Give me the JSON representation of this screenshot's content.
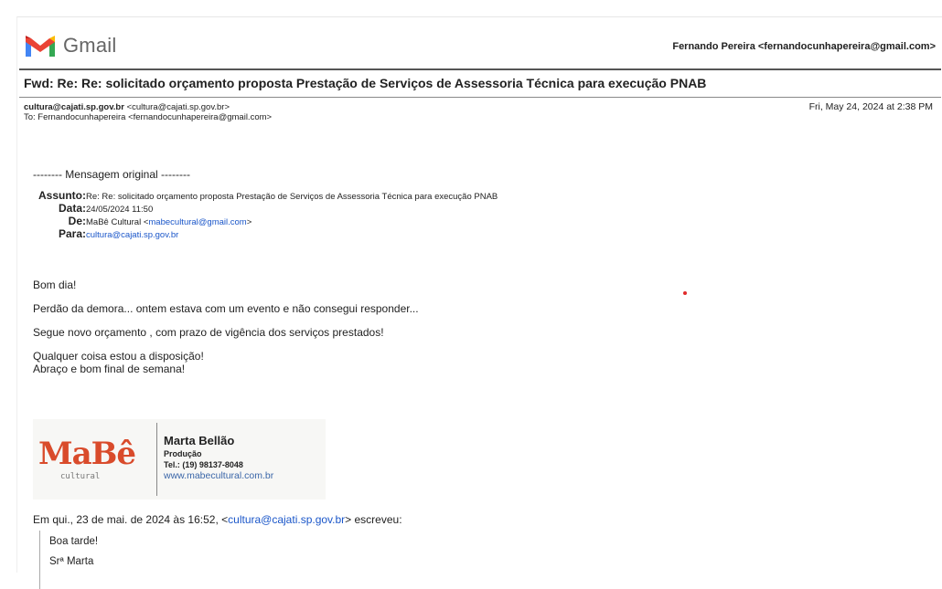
{
  "header": {
    "app_name": "Gmail",
    "account": "Fernando Pereira <fernandocunhapereira@gmail.com>"
  },
  "email": {
    "subject": "Fwd: Re: Re: solicitado orçamento proposta Prestação de Serviços de Assessoria Técnica para execução PNAB",
    "from_email": "cultura@cajati.sp.gov.br",
    "from_addr": "<cultura@cajati.sp.gov.br>",
    "to": "To: Fernandocunhapereira <fernandocunhapereira@gmail.com>",
    "date": "Fri, May 24, 2024 at 2:38 PM"
  },
  "original": {
    "header": "-------- Mensagem original --------",
    "labels": {
      "assunto": "Assunto:",
      "data": "Data:",
      "de": "De:",
      "para": "Para:"
    },
    "assunto": "Re: Re: solicitado orçamento proposta Prestação de Serviços de Assessoria Técnica para execução PNAB",
    "data": "24/05/2024 11:50",
    "de_name": "MaBê Cultural <",
    "de_email": "mabecultural@gmail.com",
    "de_close": ">",
    "para": "cultura@cajati.sp.gov.br"
  },
  "body": {
    "greeting": "Bom dia!",
    "line1": "Perdão da demora... ontem estava com um evento e não consegui responder...",
    "line2": "Segue novo orçamento , com prazo de vigência dos serviços prestados!",
    "line3": "Qualquer coisa estou a disposição!",
    "line4": "Abraço e bom final de semana!"
  },
  "signature": {
    "logo_main": "MaBê",
    "logo_sub": "cultural",
    "name": "Marta Bellão",
    "role": "Produção",
    "phone": "Tel.: (19) 98137-8048",
    "website": "www.mabecultural.com.br"
  },
  "quoted": {
    "intro_before": "Em qui., 23 de mai. de 2024 às 16:52, <",
    "intro_email": "cultura@cajati.sp.gov.br",
    "intro_after": "> escreveu:",
    "line1": "Boa tarde!",
    "line2": "Srª Marta"
  },
  "colors": {
    "link": "#1a56c9",
    "brand_red": "#ea4335",
    "mabe_orange": "#d94b2b"
  }
}
